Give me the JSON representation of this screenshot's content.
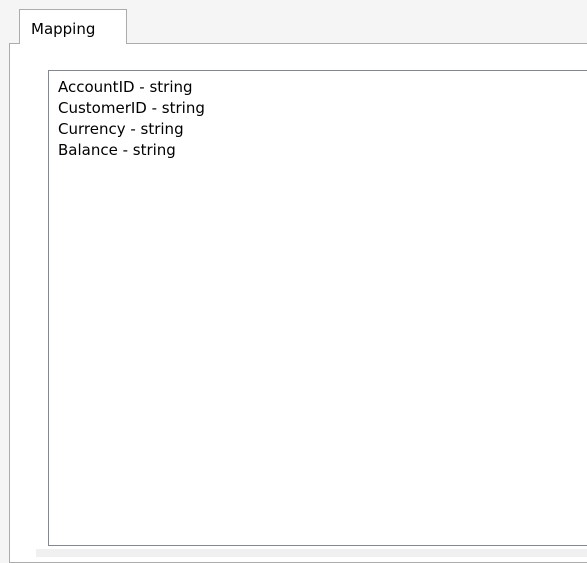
{
  "tabs": [
    {
      "label": "Mapping",
      "selected": true
    }
  ],
  "mapping_list": {
    "items": [
      "AccountID - string",
      "CustomerID - string",
      "Currency - string",
      "Balance - string"
    ]
  },
  "colors": {
    "border": "#acacac",
    "listbox_border": "#828790",
    "panel_background": "#ffffff",
    "window_background": "#f5f5f5"
  }
}
